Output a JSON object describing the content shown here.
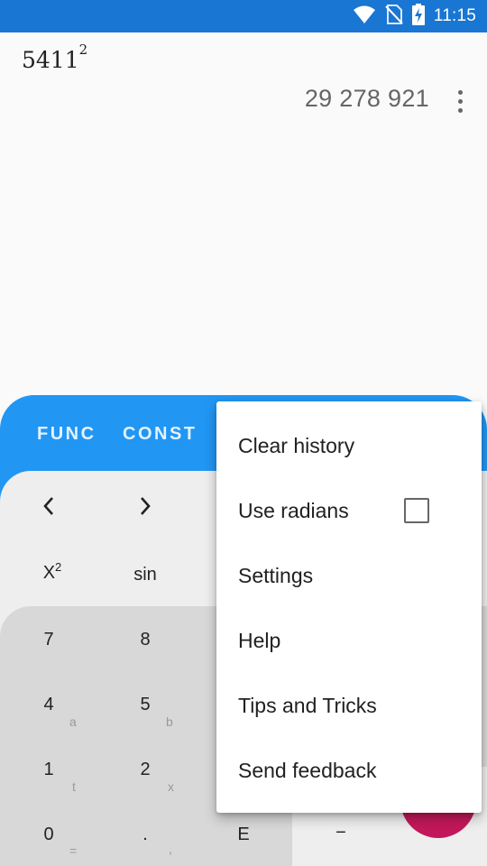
{
  "status_bar": {
    "time": "11:15",
    "icons": [
      "wifi-icon",
      "no-sim-icon",
      "battery-charging-icon"
    ],
    "background": "#1976d2"
  },
  "display": {
    "expression": "5411",
    "exponent": "2",
    "result": "29 278 921",
    "overflow_icon": "more-vert-icon"
  },
  "keypad": {
    "tabs": [
      "FUNC",
      "CONST"
    ],
    "nav_left": "<",
    "nav_right": ">",
    "func_keys": [
      "X",
      "2",
      "sin"
    ],
    "digits": [
      {
        "main": "7",
        "sub": ""
      },
      {
        "main": "8",
        "sub": ""
      },
      {
        "main": "4",
        "sub": "a"
      },
      {
        "main": "5",
        "sub": "b"
      },
      {
        "main": "1",
        "sub": "t"
      },
      {
        "main": "2",
        "sub": "x"
      },
      {
        "main": "0",
        "sub": "="
      },
      {
        "main": ".",
        "sub": ","
      },
      {
        "main": "E",
        "sub": ""
      }
    ],
    "operator_minus": "−",
    "colors": {
      "tab_strip": "#2196f3",
      "keys_light": "#eeeeee",
      "keys_gray": "#d8d8d8",
      "fab": "#c2185b"
    }
  },
  "menu": {
    "items": [
      {
        "label": "Clear history"
      },
      {
        "label": "Use radians",
        "checkbox": false
      },
      {
        "label": "Settings"
      },
      {
        "label": "Help"
      },
      {
        "label": "Tips and Tricks"
      },
      {
        "label": "Send feedback"
      }
    ]
  }
}
